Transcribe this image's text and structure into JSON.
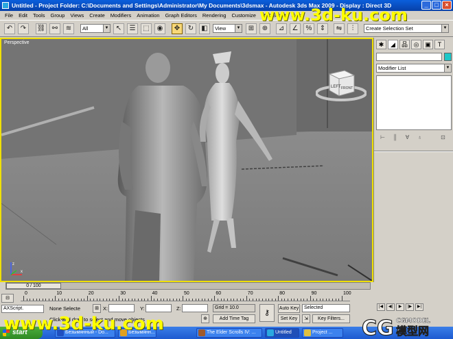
{
  "window": {
    "title": "Untitled    - Project Folder: C:\\Documents and Settings\\Administrator\\My Documents\\3dsmax    - Autodesk 3ds Max  2009       - Display : Direct 3D",
    "minimize": "_",
    "maximize": "□",
    "close": "×"
  },
  "menu": [
    "File",
    "Edit",
    "Tools",
    "Group",
    "Views",
    "Create",
    "Modifiers",
    "Animation",
    "Graph Editors",
    "Rendering",
    "Customize",
    "MAXScript",
    "Help"
  ],
  "toolbar": {
    "selection_filter": "All",
    "reference_coord": "View",
    "named_selection": "Create Selection Set"
  },
  "viewport": {
    "label": "Perspective",
    "viewcube_face": "LEFT",
    "viewcube_face2": "FRONT",
    "axis_z": "z",
    "axis_x": "x"
  },
  "command_panel": {
    "modifier_list": "Modifier List",
    "swatch_color": "#1dc8c8"
  },
  "timeline": {
    "frame_display": "0 / 100",
    "ticks": [
      "0",
      "10",
      "20",
      "30",
      "40",
      "50",
      "60",
      "70",
      "80",
      "90",
      "100"
    ]
  },
  "status": {
    "selection": "None Selecte",
    "x_label": "X:",
    "y_label": "Y:",
    "z_label": "Z:",
    "grid": "Grid = 10.0",
    "add_time_tag": "Add Time Tag",
    "prompt": "Click and drag to select and move objects",
    "maxscript": "AXScript.",
    "auto_key": "Auto Key",
    "set_key": "Set Key",
    "key_mode": "Selected",
    "key_filters": "Key Filters..."
  },
  "taskbar": {
    "start": "start",
    "tasks": [
      "Безымянный - Do...",
      "Безымянн...",
      "The Elder Scrolls IV: ...",
      "Untitled",
      "Project ..."
    ]
  },
  "watermarks": {
    "top": "www.3d-ku.com",
    "bottom": "www.3d-ku.com",
    "cg_logo": "CGMODEL",
    "cg_sub": "模型网"
  }
}
